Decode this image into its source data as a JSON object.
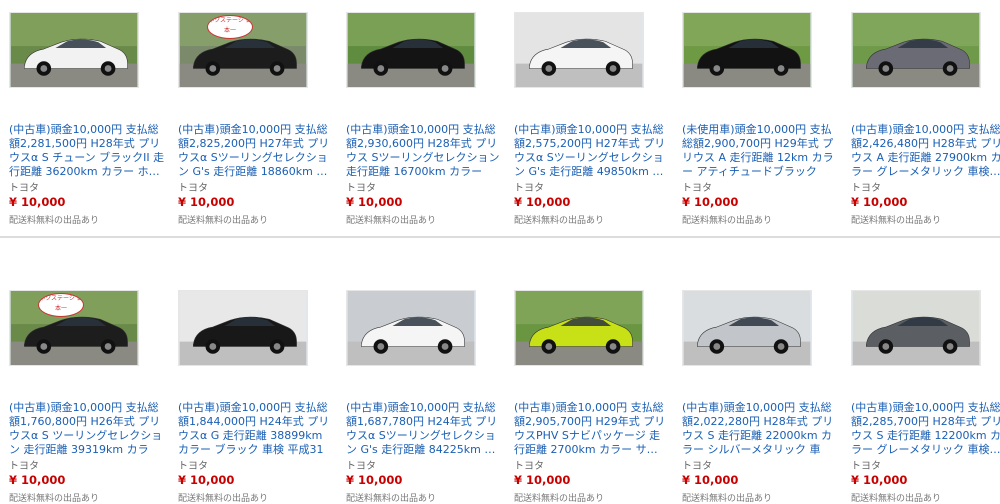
{
  "listings": [
    {
      "title": "(中古車)頭金10,000円 支払総額2,281,500円 H28年式 プリウスα S チューン ブラックII 走行距離 36200km カラー ホ…",
      "brand": "トヨタ",
      "price": "¥ 10,000",
      "shipping": "配送料無料の出品あり",
      "car_color": "#f2f2f2",
      "bg": "#6a8a4a",
      "badge": ""
    },
    {
      "title": "(中古車)頭金10,000円 支払総額2,825,200円 H27年式 プリウスα Sツーリングセレクション G's 走行距離 18860km …",
      "brand": "トヨタ",
      "price": "¥ 10,000",
      "shipping": "配送料無料の出品あり",
      "car_color": "#1c1c1c",
      "bg": "#7a8a6a",
      "badge": "ネクステージ 日本一"
    },
    {
      "title": "(中古車)頭金10,000円 支払総額2,930,600円 H28年式 プリウス Sツーリングセレクション 走行距離 16700km カラー ア…",
      "brand": "トヨタ",
      "price": "¥ 10,000",
      "shipping": "配送料無料の出品あり",
      "car_color": "#141414",
      "bg": "#5f8c3e",
      "badge": ""
    },
    {
      "title": "(中古車)頭金10,000円 支払総額2,575,200円 H27年式 プリウスα Sツーリングセレクション G's 走行距離 49850km …",
      "brand": "トヨタ",
      "price": "¥ 10,000",
      "shipping": "配送料無料の出品あり",
      "car_color": "#f5f5f5",
      "bg": "#e4e4e4",
      "badge": ""
    },
    {
      "title": "(未使用車)頭金10,000円 支払総額2,900,700円 H29年式 プリウス A 走行距離 12km カラー アティチュードブラックマ…",
      "brand": "トヨタ",
      "price": "¥ 10,000",
      "shipping": "配送料無料の出品あり",
      "car_color": "#121212",
      "bg": "#6f9a44",
      "badge": ""
    },
    {
      "title": "(中古車)頭金10,000円 支払総額2,426,480円 H28年式 プリウス A 走行距離 27900km カラー グレーメタリック 車検…",
      "brand": "トヨタ",
      "price": "¥ 10,000",
      "shipping": "配送料無料の出品あり",
      "car_color": "#6b6b75",
      "bg": "#6e9a4a",
      "badge": ""
    },
    {
      "title": "(中古車)頭金10,000円 支払総額1,760,800円 H26年式 プリウスα S ツーリングセレクション 走行距離 39319km カラー…",
      "brand": "トヨタ",
      "price": "¥ 10,000",
      "shipping": "配送料無料の出品あり",
      "car_color": "#1d1d1d",
      "bg": "#6a8a4a",
      "badge": "ネクステージ 日本一"
    },
    {
      "title": "(中古車)頭金10,000円 支払総額1,844,000円 H24年式 プリウスα G 走行距離 38899km カラー ブラック 車検 平成31年…",
      "brand": "トヨタ",
      "price": "¥ 10,000",
      "shipping": "配送料無料の出品あり",
      "car_color": "#181818",
      "bg": "#e8e8e8",
      "badge": ""
    },
    {
      "title": "(中古車)頭金10,000円 支払総額1,687,780円 H24年式 プリウスα Sツーリングセレクション G's 走行距離 84225km …",
      "brand": "トヨタ",
      "price": "¥ 10,000",
      "shipping": "配送料無料の出品あり",
      "car_color": "#f5f5f5",
      "bg": "#c9cdd2",
      "badge": ""
    },
    {
      "title": "(中古車)頭金10,000円 支払総額2,905,700円 H29年式 プリウスPHV Sナビパッケージ 走行距離 2700km カラー サ…",
      "brand": "トヨタ",
      "price": "¥ 10,000",
      "shipping": "配送料無料の出品あり",
      "car_color": "#c8e016",
      "bg": "#6a9642",
      "badge": ""
    },
    {
      "title": "(中古車)頭金10,000円 支払総額2,022,280円 H28年式 プリウス S 走行距離 22000km カラー シルバーメタリック 車検…",
      "brand": "トヨタ",
      "price": "¥ 10,000",
      "shipping": "配送料無料の出品あり",
      "car_color": "#c2c5c9",
      "bg": "#d9dde0",
      "badge": ""
    },
    {
      "title": "(中古車)頭金10,000円 支払総額2,285,700円 H28年式 プリウス S 走行距離 12200km カラー グレーメタリック 車検…",
      "brand": "トヨタ",
      "price": "¥ 10,000",
      "shipping": "配送料無料の出品あり",
      "car_color": "#5b5e63",
      "bg": "#dadcd8",
      "badge": ""
    }
  ]
}
